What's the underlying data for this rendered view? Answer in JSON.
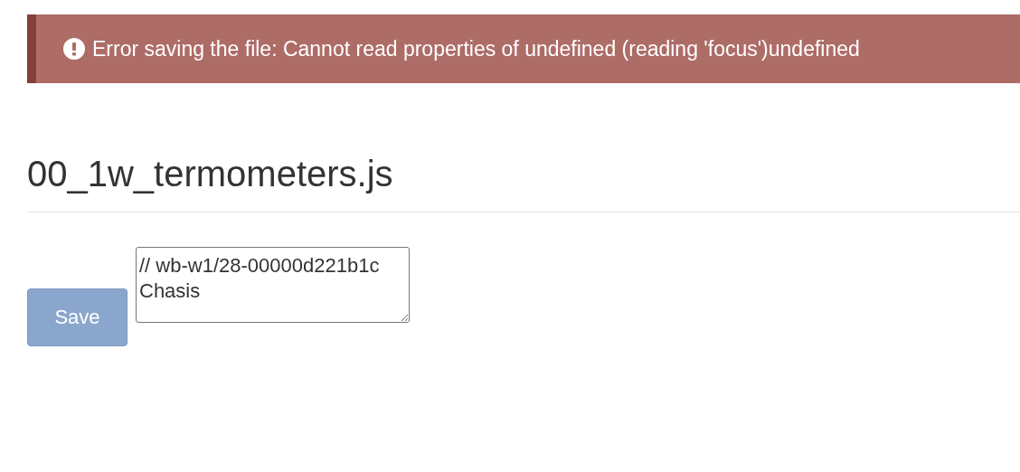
{
  "alert": {
    "kind": "error",
    "message": "Error saving the file: Cannot read properties of undefined (reading 'focus')undefined"
  },
  "file": {
    "title": "00_1w_termometers.js",
    "content": "// wb-w1/28-00000d221b1c Chasis"
  },
  "save_button": {
    "label": "Save",
    "disabled": true
  }
}
